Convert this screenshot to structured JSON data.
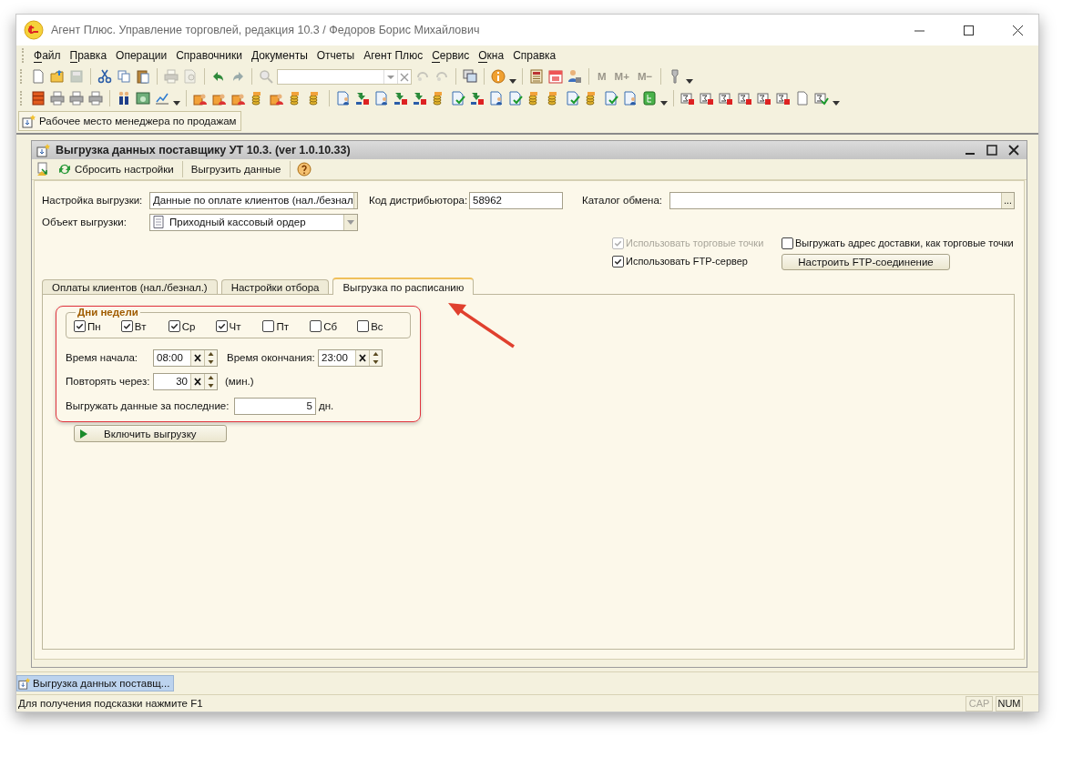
{
  "window": {
    "title": "Агент Плюс. Управление торговлей, редакция 10.3 / Федоров Борис Михайлович"
  },
  "menu": [
    {
      "label": "Файл",
      "mnemonic": true
    },
    {
      "label": "Правка",
      "mnemonic": true
    },
    {
      "label": "Операции",
      "mnemonic": false
    },
    {
      "label": "Справочники",
      "mnemonic": false
    },
    {
      "label": "Документы",
      "mnemonic": false
    },
    {
      "label": "Отчеты",
      "mnemonic": false
    },
    {
      "label": "Агент Плюс",
      "mnemonic": false
    },
    {
      "label": "Сервис",
      "mnemonic": true
    },
    {
      "label": "Окна",
      "mnemonic": true
    },
    {
      "label": "Справка",
      "mnemonic": false
    }
  ],
  "memory_buttons": [
    {
      "label": "M",
      "disabled": true
    },
    {
      "label": "M+",
      "disabled": true
    },
    {
      "label": "M−",
      "disabled": true
    }
  ],
  "panel_button": "Рабочее место менеджера по продажам",
  "form": {
    "title": "Выгрузка данных поставщику УТ 10.3. (ver 1.0.10.33)",
    "toolbar_buttons": [
      "Сбросить настройки",
      "Выгрузить данные"
    ],
    "setting": {
      "label": "Настройка выгрузки:",
      "value": "Данные по оплате клиентов (нал./безнал"
    },
    "distributor": {
      "label": "Код дистрибьютора:",
      "value": "58962"
    },
    "catalog": {
      "label": "Каталог обмена:",
      "button": "..."
    },
    "object": {
      "label": "Объект выгрузки:",
      "value": "Приходный кассовый ордер"
    },
    "options": [
      {
        "label": "Использовать торговые точки",
        "checked": true,
        "disabled": true
      },
      {
        "label": "Использовать FTP-сервер",
        "checked": true,
        "disabled": false
      }
    ],
    "delivery_option": {
      "label": "Выгружать адрес доставки, как торговые точки",
      "checked": false
    },
    "ftp_button": "Настроить FTP-соединение",
    "tabs": [
      {
        "label": "Оплаты клиентов (нал./безнал.)",
        "selected": false
      },
      {
        "label": "Настройки отбора",
        "selected": false
      },
      {
        "label": "Выгрузка по расписанию",
        "selected": true
      }
    ],
    "schedule": {
      "group_title": "Дни недели",
      "days": [
        {
          "label": "Пн",
          "checked": true
        },
        {
          "label": "Вт",
          "checked": true
        },
        {
          "label": "Ср",
          "checked": true
        },
        {
          "label": "Чт",
          "checked": true
        },
        {
          "label": "Пт",
          "checked": false
        },
        {
          "label": "Сб",
          "checked": false
        },
        {
          "label": "Вс",
          "checked": false
        }
      ],
      "start": {
        "label": "Время начала:",
        "value": "08:00"
      },
      "end": {
        "label": "Время окончания:",
        "value": "23:00"
      },
      "repeat": {
        "label": "Повторять через:",
        "value": "30",
        "unit": "(мин.)"
      },
      "period": {
        "label": "Выгружать данные за последние:",
        "value": "5",
        "unit": "дн."
      }
    },
    "enable_button": "Включить выгрузку"
  },
  "taskbar": [
    {
      "label": "Выгрузка данных поставщ...",
      "selected": true
    }
  ],
  "status_bar": {
    "hint": "Для получения подсказки нажмите F1",
    "indicators": [
      {
        "label": "CAP",
        "on": false
      },
      {
        "label": "NUM",
        "on": true
      }
    ]
  }
}
